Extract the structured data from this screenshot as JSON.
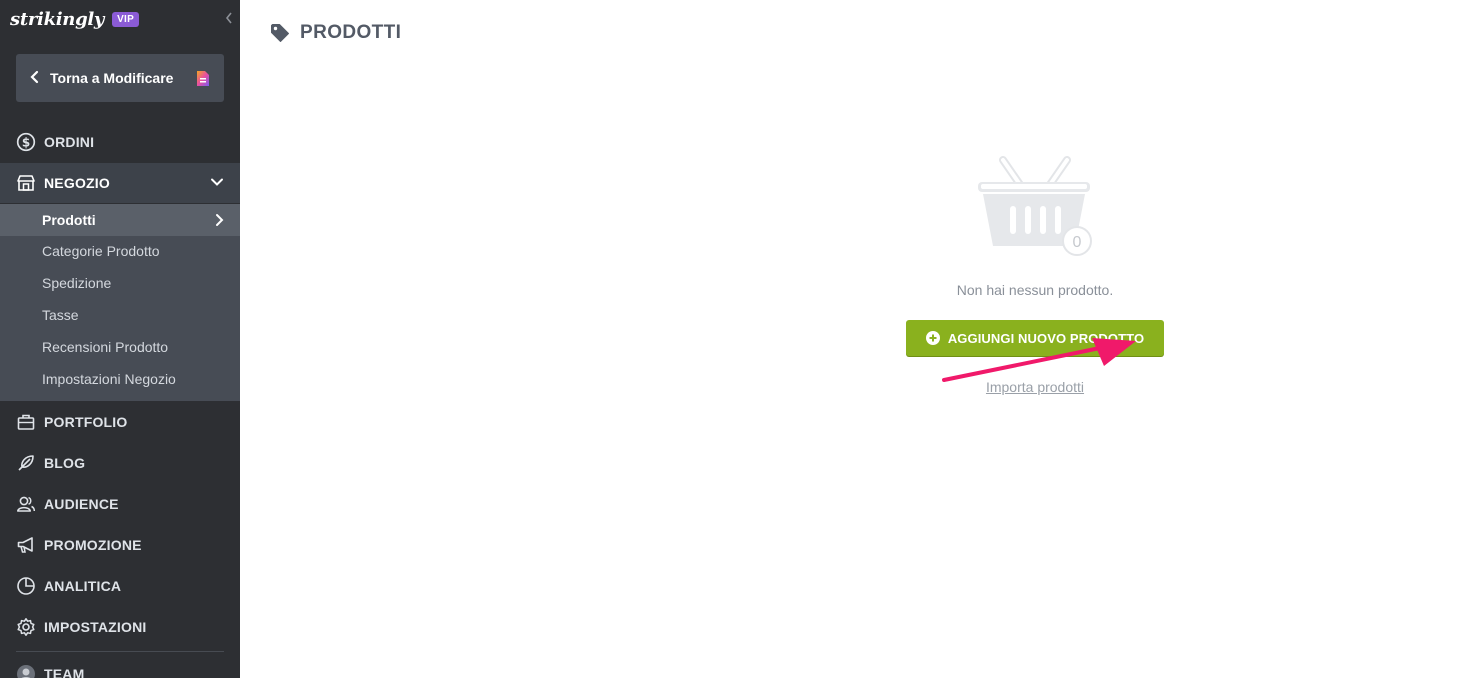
{
  "brand": {
    "name": "strikingly",
    "badge": "VIP"
  },
  "sidebar": {
    "back_button": "Torna a Modificare",
    "nav": {
      "ordini": "ORDINI",
      "negozio": "NEGOZIO",
      "portfolio": "PORTFOLIO",
      "blog": "BLOG",
      "audience": "AUDIENCE",
      "promozione": "PROMOZIONE",
      "analitica": "ANALITICA",
      "impostazioni": "IMPOSTAZIONI",
      "team": "TEAM"
    },
    "store_submenu": [
      "Prodotti",
      "Categorie Prodotto",
      "Spedizione",
      "Tasse",
      "Recensioni Prodotto",
      "Impostazioni Negozio"
    ]
  },
  "main": {
    "title": "PRODOTTI",
    "basket_count": "0",
    "empty_message": "Non hai nessun prodotto.",
    "add_button": "AGGIUNGI NUOVO PRODOTTO",
    "import_link": "Importa prodotti"
  },
  "colors": {
    "sidebar_bg": "#2d2f33",
    "submenu_bg": "#474c55",
    "active_item_bg": "#5a6069",
    "accent_green": "#8ab11e",
    "vip_purple": "#8b5bd6",
    "arrow_pink": "#f0196a"
  }
}
